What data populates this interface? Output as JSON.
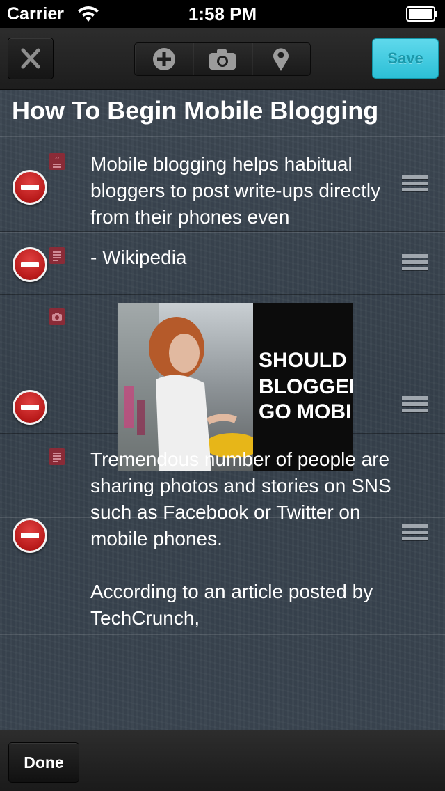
{
  "status_bar": {
    "carrier": "Carrier",
    "time": "1:58 PM"
  },
  "toolbar": {
    "save_label": "Save"
  },
  "post": {
    "title": "How To Begin Mobile Blogging",
    "blocks": [
      {
        "type": "quote",
        "text": "Mobile blogging helps habitual bloggers to post write-ups directly from their phones even"
      },
      {
        "type": "text",
        "text": "- Wikipedia"
      },
      {
        "type": "photo",
        "lines": [
          "SHOULD",
          "BLOGGERS",
          "GO MOBILE?"
        ]
      },
      {
        "type": "text",
        "paragraphs": [
          "Tremendous number of people are sharing photos and stories on SNS such as Facebook or Twitter on mobile phones.",
          "According to an article posted by TechCrunch,"
        ]
      }
    ]
  },
  "bottom_bar": {
    "done_label": "Done"
  },
  "colors": {
    "save_accent": "#2cbfd6",
    "delete_red": "#c41f1f",
    "type_icon": "#8a2b37"
  }
}
